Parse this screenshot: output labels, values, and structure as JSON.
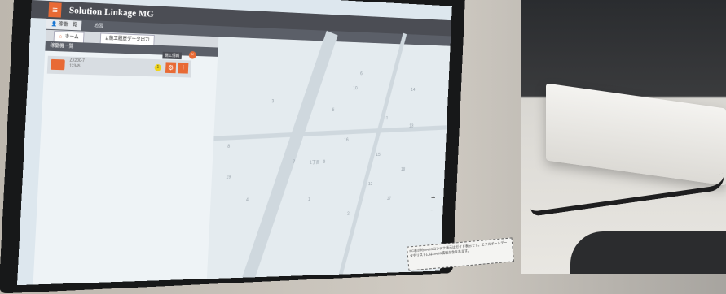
{
  "app": {
    "title": "Solution Linkage MG",
    "menu_icon": "hamburger-icon"
  },
  "nav": {
    "items": [
      {
        "label": "稼働一覧",
        "icon": "user-icon"
      },
      {
        "label": "地図"
      }
    ]
  },
  "tabs": [
    {
      "label": "ホーム",
      "icon": "home-icon"
    },
    {
      "label": "施工履歴データ出力",
      "icon": "download-icon"
    }
  ],
  "panel": {
    "title": "稼働機一覧",
    "row": {
      "line1": "ZX200-7",
      "line2": "12345",
      "badge": "1",
      "tooltip": "施工情報",
      "gear": "⚙",
      "info": "i",
      "close": "×"
    }
  },
  "map": {
    "numbers": [
      "3",
      "5",
      "6",
      "8",
      "11",
      "15",
      "16",
      "17",
      "18",
      "19",
      "7",
      "9",
      "1",
      "2",
      "12",
      "14",
      "4",
      "10",
      "13"
    ],
    "block_label": "1丁目",
    "zoom_in": "+",
    "zoom_out": "−"
  },
  "notice": {
    "text": "PC表示時GNSSコンテナ表示はガイド表示です。エクスポートデータやリストにはGNSS情報が含まれます。"
  },
  "colors": {
    "accent": "#e86a35",
    "header": "#4b4d54"
  }
}
